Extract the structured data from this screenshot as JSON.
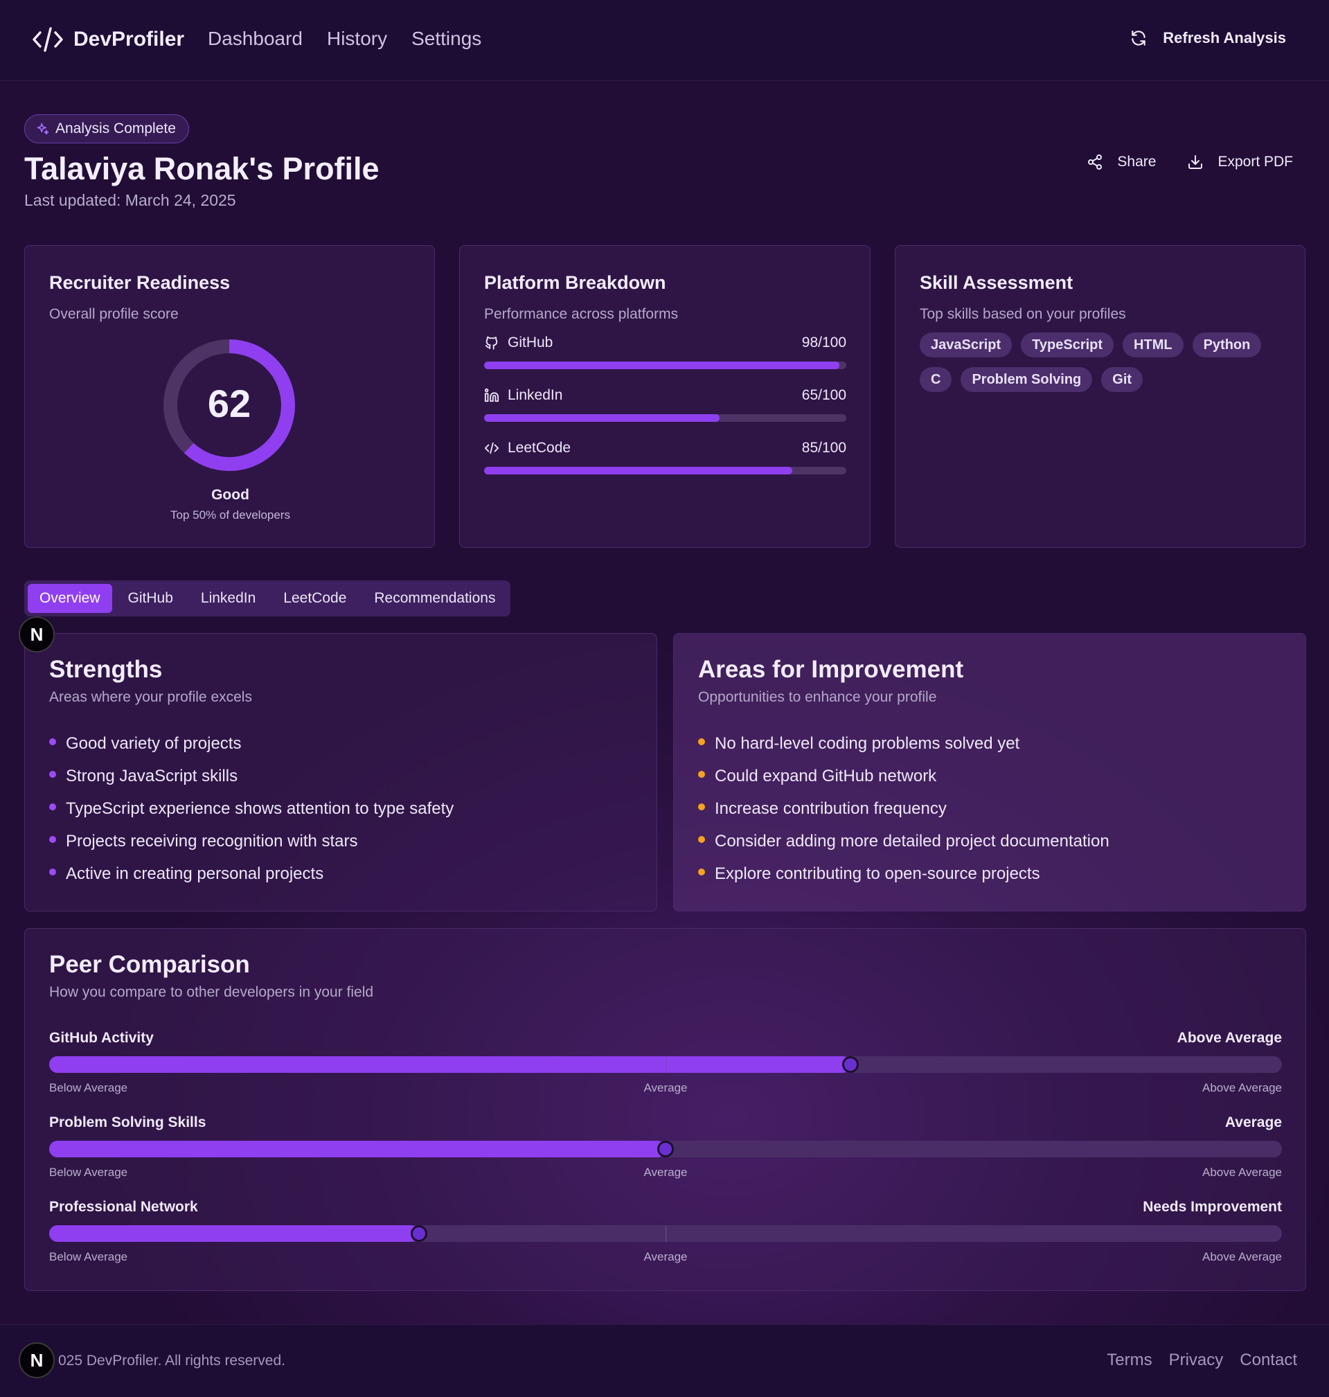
{
  "header": {
    "brand": "DevProfiler",
    "nav": [
      "Dashboard",
      "History",
      "Settings"
    ],
    "refresh_label": "Refresh Analysis"
  },
  "page": {
    "badge": "Analysis Complete",
    "title": "Talaviya Ronak's Profile",
    "updated": "Last updated: March 24, 2025",
    "share_label": "Share",
    "export_label": "Export PDF"
  },
  "readiness": {
    "title": "Recruiter Readiness",
    "subtitle": "Overall profile score",
    "score": 62,
    "score_text": "62",
    "rating": "Good",
    "rank": "Top 50% of developers"
  },
  "platforms": {
    "title": "Platform Breakdown",
    "subtitle": "Performance across platforms",
    "items": [
      {
        "name": "GitHub",
        "score": 98,
        "score_text": "98/100",
        "icon": "github-icon"
      },
      {
        "name": "LinkedIn",
        "score": 65,
        "score_text": "65/100",
        "icon": "linkedin-icon"
      },
      {
        "name": "LeetCode",
        "score": 85,
        "score_text": "85/100",
        "icon": "code-icon"
      }
    ]
  },
  "skills": {
    "title": "Skill Assessment",
    "subtitle": "Top skills based on your profiles",
    "items": [
      "JavaScript",
      "TypeScript",
      "HTML",
      "Python",
      "C",
      "Problem Solving",
      "Git"
    ]
  },
  "tabs": [
    "Overview",
    "GitHub",
    "LinkedIn",
    "LeetCode",
    "Recommendations"
  ],
  "active_tab": "Overview",
  "strengths": {
    "title": "Strengths",
    "subtitle": "Areas where your profile excels",
    "items": [
      "Good variety of projects",
      "Strong JavaScript skills",
      "TypeScript experience shows attention to type safety",
      "Projects receiving recognition with stars",
      "Active in creating personal projects"
    ]
  },
  "improvements": {
    "title": "Areas for Improvement",
    "subtitle": "Opportunities to enhance your profile",
    "items": [
      "No hard-level coding problems solved yet",
      "Could expand GitHub network",
      "Increase contribution frequency",
      "Consider adding more detailed project documentation",
      "Explore contributing to open-source projects"
    ]
  },
  "peer": {
    "title": "Peer Comparison",
    "subtitle": "How you compare to other developers in your field",
    "scale": [
      "Below Average",
      "Average",
      "Above Average"
    ],
    "metrics": [
      {
        "name": "GitHub Activity",
        "rating": "Above Average",
        "percent": 65
      },
      {
        "name": "Problem Solving Skills",
        "rating": "Average",
        "percent": 50
      },
      {
        "name": "Professional Network",
        "rating": "Needs Improvement",
        "percent": 30
      }
    ]
  },
  "footer": {
    "copyright": "025 DevProfiler. All rights reserved.",
    "links": [
      "Terms",
      "Privacy",
      "Contact"
    ]
  },
  "colors": {
    "accent": "#8f3ff0",
    "improvement_bullet": "#f5a320"
  }
}
